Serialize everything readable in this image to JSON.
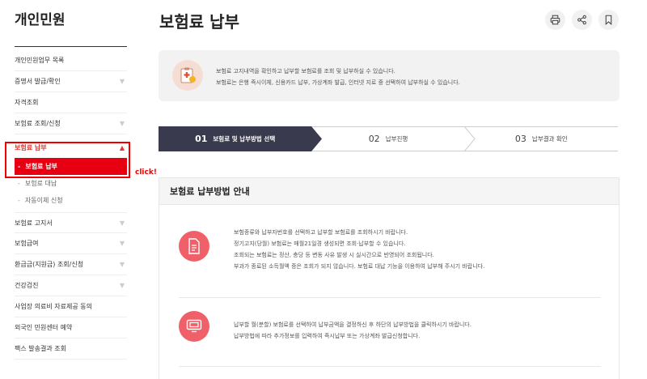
{
  "sidebar": {
    "title": "개인민원",
    "items": [
      {
        "label": "개인민원업무 목록",
        "chevron": false
      },
      {
        "label": "증명서 발급/확인",
        "chevron": true
      },
      {
        "label": "자격조회",
        "chevron": false
      },
      {
        "label": "보험료 조회/신청",
        "chevron": true
      }
    ],
    "open_item": {
      "label": "보험료 납부",
      "icon": "chevron-up-icon"
    },
    "sub_items": [
      {
        "label": "보험료 납부",
        "active": true
      },
      {
        "label": "보험료 대납",
        "active": false
      },
      {
        "label": "자동이체 신청",
        "active": false
      }
    ],
    "items_after": [
      {
        "label": "보험료 고지서",
        "chevron": true
      },
      {
        "label": "보험급여",
        "chevron": true
      },
      {
        "label": "환급금(지원금) 조회/신청",
        "chevron": true
      },
      {
        "label": "건강검진",
        "chevron": true
      },
      {
        "label": "사업장 의료비 자료제공 동의",
        "chevron": false
      },
      {
        "label": "외국인 민원센터 예약",
        "chevron": false
      },
      {
        "label": "팩스 발송결과 조회",
        "chevron": false
      }
    ]
  },
  "annotation": {
    "text": "click!",
    "color": "#ee0000"
  },
  "header": {
    "title": "보험료 납부",
    "tools": [
      "print-icon",
      "share-icon",
      "bookmark-icon"
    ]
  },
  "notice": {
    "line1": "보험료 고지내역을 확인하고 납부할 보험료를 조회 및 납부하실 수 있습니다.",
    "line2": "보험료는 은행 즉시이체, 신용카드 납부, 가상계좌 발급, 인터넷 지로 중 선택하여 납부하실 수 있습니다."
  },
  "steps": [
    {
      "num": "01",
      "label": "보험료 및 납부방법 선택",
      "active": true
    },
    {
      "num": "02",
      "label": "납부진행",
      "active": false
    },
    {
      "num": "03",
      "label": "납부결과 확인",
      "active": false
    }
  ],
  "guide": {
    "title": "보험료 납부방법 안내",
    "row1": {
      "icon": "document-icon",
      "lines": [
        "보험종류와 납부자번호를 선택하고 납부할 보험료를 조회하시기 바랍니다.",
        "정기고지(당월) 보험료는 매월21일경 생성되면 조회·납부할 수 있습니다.",
        "조회되는 보험료는 정산, 충당 등 변동 사유 발생 시 실시간으로 반영되어 조회됩니다.",
        "부과가 종료된 소득월액 증은 조회가 되지 않습니다. 보험료 대납 기능을 이용하여 납부해 주시기 바랍니다."
      ]
    },
    "row2": {
      "icon": "payment-terminal-icon",
      "lines": [
        "납부할 월(분할) 보험료를 선택하여 납부금액을 결정하신 후 하단의 납부방법을 클릭하시기 바랍니다.",
        "납부방법에 따라 추가정보를 입력하여 즉시납부 또는 가상계좌 발급신청합니다."
      ]
    }
  },
  "colors": {
    "accent_red": "#e60012",
    "step_active": "#3a3a4e",
    "icon_red": "#f06068"
  }
}
